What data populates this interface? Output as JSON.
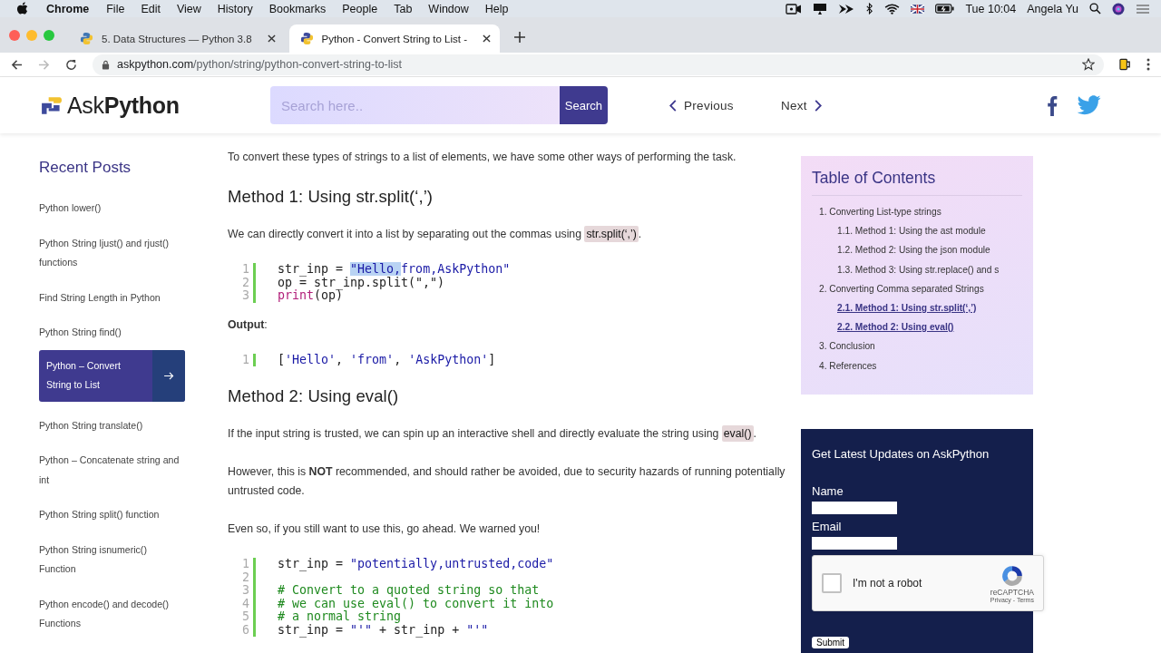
{
  "menu_bar": {
    "app": "Chrome",
    "menus": [
      "File",
      "Edit",
      "View",
      "History",
      "Bookmarks",
      "People",
      "Tab",
      "Window",
      "Help"
    ],
    "clock": "Tue 10:04",
    "user": "Angela Yu"
  },
  "tabs": [
    {
      "title": "5. Data Structures — Python 3.8",
      "selected": false
    },
    {
      "title": "Python - Convert String to List -",
      "selected": true
    }
  ],
  "address_bar": {
    "domain": "askpython.com",
    "path": "/python/string/python-convert-string-to-list"
  },
  "header": {
    "logo_light": "Ask",
    "logo_bold": "Python",
    "search_placeholder": "Search here..",
    "search_button": "Search",
    "previous": "Previous",
    "next": "Next"
  },
  "sidebar": {
    "title": "Recent Posts",
    "items": [
      {
        "label": "Python lower()",
        "selected": false
      },
      {
        "label": "Python String ljust() and rjust() functions",
        "selected": false
      },
      {
        "label": "Find String Length in Python",
        "selected": false
      },
      {
        "label": "Python String find()",
        "selected": false
      },
      {
        "label": "Python – Convert String to List",
        "selected": true
      },
      {
        "label": "Python String translate()",
        "selected": false
      },
      {
        "label": "Python – Concatenate string and int",
        "selected": false
      },
      {
        "label": "Python String split() function",
        "selected": false
      },
      {
        "label": "Python String isnumeric() Function",
        "selected": false
      },
      {
        "label": "Python encode() and decode() Functions",
        "selected": false
      }
    ]
  },
  "article": [
    {
      "kind": "para",
      "segments": [
        {
          "kind": "text",
          "text": "To convert these types of strings to a list of elements, we have some other ways of performing the task."
        }
      ]
    },
    {
      "kind": "heading",
      "text": "Method 1: Using str.split(‘,’)"
    },
    {
      "kind": "para",
      "segments": [
        {
          "kind": "text",
          "text": "We can directly convert it into a list by separating out the commas using "
        },
        {
          "kind": "code",
          "text": "str.split(‘,’)"
        },
        {
          "kind": "text",
          "text": "."
        }
      ]
    },
    {
      "kind": "code",
      "lines": [
        {
          "n": "1",
          "tokens": [
            {
              "kind": "plain",
              "text": "str_inp = ",
              "highlighted": false
            },
            {
              "kind": "string",
              "text": "\"Hello,",
              "highlighted": true
            },
            {
              "kind": "string",
              "text": "from,AskPython\"",
              "highlighted": false
            }
          ]
        },
        {
          "n": "2",
          "tokens": [
            {
              "kind": "plain",
              "text": "op = str_inp.split(\",\")",
              "highlighted": false
            }
          ]
        },
        {
          "n": "3",
          "tokens": [
            {
              "kind": "builtin",
              "text": "print",
              "highlighted": false
            },
            {
              "kind": "plain",
              "text": "(op)",
              "highlighted": false
            }
          ]
        }
      ]
    },
    {
      "kind": "para",
      "segments": [
        {
          "kind": "text",
          "text": "**Output**:"
        }
      ]
    },
    {
      "kind": "code",
      "lines": [
        {
          "n": "1",
          "tokens": [
            {
              "kind": "plain",
              "text": "[",
              "highlighted": false
            },
            {
              "kind": "string",
              "text": "'Hello'",
              "highlighted": false
            },
            {
              "kind": "plain",
              "text": ", ",
              "highlighted": false
            },
            {
              "kind": "string",
              "text": "'from'",
              "highlighted": false
            },
            {
              "kind": "plain",
              "text": ", ",
              "highlighted": false
            },
            {
              "kind": "string",
              "text": "'AskPython'",
              "highlighted": false
            },
            {
              "kind": "plain",
              "text": "]",
              "highlighted": false
            }
          ]
        }
      ]
    },
    {
      "kind": "heading",
      "text": "Method 2: Using eval()"
    },
    {
      "kind": "para",
      "segments": [
        {
          "kind": "text",
          "text": "If the input string is trusted, we can spin up an interactive shell and directly evaluate the string using "
        },
        {
          "kind": "code",
          "text": "eval()"
        },
        {
          "kind": "text",
          "text": "."
        }
      ]
    },
    {
      "kind": "para",
      "segments": [
        {
          "kind": "text",
          "text": "However, this is **NOT** recommended, and should rather be avoided, due to security hazards of running potentially untrusted code."
        }
      ]
    },
    {
      "kind": "para",
      "segments": [
        {
          "kind": "text",
          "text": "Even so, if you still want to use this, go ahead. We warned you!"
        }
      ]
    },
    {
      "kind": "code",
      "lines": [
        {
          "n": "1",
          "tokens": [
            {
              "kind": "plain",
              "text": "str_inp = ",
              "highlighted": false
            },
            {
              "kind": "string",
              "text": "\"potentially,untrusted,code\"",
              "highlighted": false
            }
          ]
        },
        {
          "n": "2"
        },
        {
          "n": "3",
          "tokens": [
            {
              "kind": "comment",
              "text": "# Convert to a quoted string so that",
              "highlighted": false
            }
          ]
        },
        {
          "n": "4",
          "tokens": [
            {
              "kind": "comment",
              "text": "# we can use eval() to convert it into",
              "highlighted": false
            }
          ]
        },
        {
          "n": "5",
          "tokens": [
            {
              "kind": "comment",
              "text": "# a normal string",
              "highlighted": false
            }
          ]
        },
        {
          "n": "6",
          "tokens": [
            {
              "kind": "plain",
              "text": "str_inp = ",
              "highlighted": false
            },
            {
              "kind": "string",
              "text": "\"'\"",
              "highlighted": false
            },
            {
              "kind": "plain",
              "text": " + str_inp + ",
              "highlighted": false
            },
            {
              "kind": "string",
              "text": "\"'\"",
              "highlighted": false
            }
          ]
        }
      ]
    }
  ],
  "toc": {
    "title": "Table of Contents",
    "items": [
      {
        "label": "1. Converting List-type strings",
        "active": false,
        "children": [
          {
            "label": "1.1. Method 1: Using the ast module",
            "active": false
          },
          {
            "label": "1.2. Method 2: Using the json module",
            "active": false
          },
          {
            "label": "1.3. Method 3: Using str.replace() and s",
            "active": false
          }
        ]
      },
      {
        "label": "2. Converting Comma separated Strings",
        "active": false,
        "children": [
          {
            "label": "2.1. Method 1: Using str.split(‘,’)",
            "active": true
          },
          {
            "label": "2.2. Method 2: Using eval()",
            "active": true
          }
        ]
      },
      {
        "label": "3. Conclusion",
        "active": false
      },
      {
        "label": "4. References",
        "active": false
      }
    ]
  },
  "newsletter": {
    "title": "Get Latest Updates on AskPython",
    "fields": [
      "Name",
      "Email"
    ],
    "captcha": {
      "label": "I'm not a robot",
      "checked": false,
      "brand": "reCAPTCHA",
      "links": "Privacy - Terms"
    },
    "submit": "Submit"
  }
}
